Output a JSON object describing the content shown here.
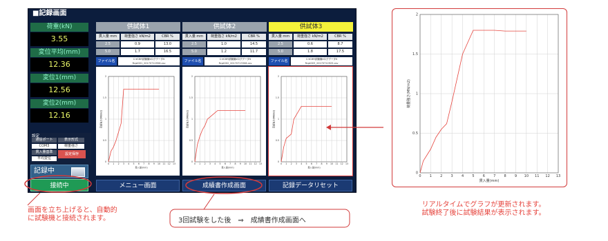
{
  "app": {
    "title": "■記録画面"
  },
  "left_panel": {
    "load_label": "荷重(kN)",
    "load_value": "3.55",
    "disp_avg_label": "変位平均(mm)",
    "disp_avg_value": "12.36",
    "disp1_label": "変位1(mm)",
    "disp1_value": "12.56",
    "disp2_label": "変位2(mm)",
    "disp2_value": "12.16"
  },
  "settings": {
    "title": "設定",
    "port": "通信ポート",
    "display_format": "表示形式",
    "com": "COM3",
    "load_strength": "荷重強さ",
    "penetration": "貫入量基準",
    "save": "設定保存",
    "avg_disp": "平均変位"
  },
  "status": {
    "recording": "記録中"
  },
  "buttons": {
    "connecting": "接続中",
    "menu": "メニュー画面",
    "report": "成績書作成画面",
    "reset": "記録データリセット"
  },
  "table_headers": {
    "pen": "貫入量 mm",
    "load": "荷重強さ kN/m2",
    "cbr": "CBR %",
    "file": "ファイル名"
  },
  "specimens": [
    {
      "name": "供試体1",
      "rows": [
        [
          "2.5",
          "0.9",
          "13.0"
        ],
        [
          "5.0",
          "1.7",
          "16.5"
        ]
      ],
      "file": "C:¥CBR試験機¥ログデータ¥ Rcpt001_20170712956.csv"
    },
    {
      "name": "供試体2",
      "rows": [
        [
          "2.5",
          "1.0",
          "14.5"
        ],
        [
          "5.0",
          "1.2",
          "11.7"
        ]
      ],
      "file": "C:¥CBR試験機¥ログデータ¥ Rcpt002_20170713306.csv"
    },
    {
      "name": "供試体3",
      "rows": [
        [
          "2.5",
          "0.6",
          "8.7"
        ],
        [
          "5.0",
          "1.8",
          "17.5"
        ]
      ],
      "file": "C:¥CBR試験機¥ログデータ¥ Rcpt003_20170712925.csv"
    }
  ],
  "small_graph": {
    "ylabel": "荷重強さ(MN/m2)",
    "xlabel": "貫入量(mm)",
    "yticks": [
      "2",
      "1.5",
      "1",
      "0.5",
      "0"
    ],
    "xticks": [
      "0",
      "1",
      "2",
      "3",
      "4",
      "5",
      "6",
      "7",
      "8",
      "9",
      "10",
      "11",
      "12",
      "13"
    ]
  },
  "big_graph": {
    "ylabel": "荷重強さ(MN/m2)",
    "xlabel": "貫入量(mm)",
    "yticks": [
      "2",
      "1.5",
      "1",
      "0.5",
      "0"
    ],
    "xticks": [
      "0",
      "1",
      "2",
      "3",
      "4",
      "5",
      "6",
      "7",
      "8",
      "9",
      "10",
      "11",
      "12",
      "13"
    ]
  },
  "chart_data": [
    {
      "type": "line",
      "name": "供試体1",
      "x": [
        0,
        0.5,
        1,
        1.5,
        2,
        2.5,
        3,
        3.5,
        4,
        5,
        6,
        7,
        8,
        9,
        10
      ],
      "y": [
        0,
        0.25,
        0.35,
        0.5,
        0.7,
        0.9,
        1.7,
        1.7,
        1.7,
        1.7,
        1.7,
        1.7,
        1.7,
        1.7,
        1.7
      ],
      "xlim": [
        0,
        13
      ],
      "ylim": [
        0,
        2
      ]
    },
    {
      "type": "line",
      "name": "供試体2",
      "x": [
        0,
        0.5,
        1,
        1.5,
        2,
        2.5,
        3,
        3.5,
        4,
        4.5,
        5,
        6,
        7,
        8,
        9,
        10
      ],
      "y": [
        0,
        0.4,
        0.6,
        0.75,
        0.85,
        1.0,
        1.05,
        1.1,
        1.15,
        1.2,
        1.2,
        1.2,
        1.2,
        1.2,
        1.2,
        1.2
      ],
      "xlim": [
        0,
        13
      ],
      "ylim": [
        0,
        2
      ]
    },
    {
      "type": "line",
      "name": "供試体3",
      "x": [
        0,
        0.5,
        1,
        1.5,
        2,
        2.5,
        3,
        3.5,
        4,
        4.5,
        5,
        6,
        7,
        8,
        9,
        10
      ],
      "y": [
        0,
        0.35,
        0.55,
        0.6,
        0.65,
        1.0,
        1.1,
        1.2,
        1.3,
        1.3,
        1.3,
        1.3,
        1.3,
        1.3,
        1.3,
        1.3
      ],
      "xlim": [
        0,
        13
      ],
      "ylim": [
        0,
        2
      ]
    },
    {
      "type": "line",
      "name": "拡大",
      "x": [
        0,
        0.3,
        1,
        1.5,
        2,
        2.5,
        3,
        3.5,
        4,
        4.5,
        5,
        6,
        7,
        8,
        9,
        10
      ],
      "y": [
        0,
        0.15,
        0.3,
        0.45,
        0.55,
        0.62,
        0.9,
        1.2,
        1.5,
        1.65,
        1.8,
        1.8,
        1.8,
        1.79,
        1.79,
        1.79
      ],
      "xlim": [
        0,
        13
      ],
      "ylim": [
        0,
        2
      ]
    }
  ],
  "callouts": {
    "left_line1": "画面を立ち上げると、自動的",
    "left_line2": "に試験機と接続されます。",
    "center": "3回試験をした後　⇒　成績書作成画面へ",
    "right_line1": "リアルタイムでグラフが更新されます。",
    "right_line2": "試験終了後に試験結果が表示されます。"
  },
  "colors": {
    "accent_red": "#e6453e",
    "spec3_yellow": "#f5f23a",
    "window_bg": "#0c1d3d"
  }
}
